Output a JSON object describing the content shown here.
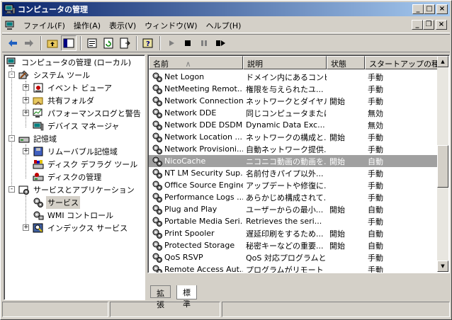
{
  "window": {
    "title": "コンピュータの管理"
  },
  "menu": [
    "ファイル(F)",
    "操作(A)",
    "表示(V)",
    "ウィンドウ(W)",
    "ヘルプ(H)"
  ],
  "tree": {
    "root": "コンピュータの管理 (ローカル)",
    "items": [
      {
        "label": "システム ツール",
        "level": 1,
        "icon": "tools-icon",
        "expander": "-"
      },
      {
        "label": "イベント ビューア",
        "level": 2,
        "icon": "event-viewer-icon",
        "expander": "+"
      },
      {
        "label": "共有フォルダ",
        "level": 2,
        "icon": "shared-folder-icon",
        "expander": "+"
      },
      {
        "label": "パフォーマンスログと警告",
        "level": 2,
        "icon": "performance-icon",
        "expander": "+"
      },
      {
        "label": "デバイス マネージャ",
        "level": 2,
        "icon": "device-manager-icon",
        "expander": ""
      },
      {
        "label": "記憶域",
        "level": 1,
        "icon": "storage-icon",
        "expander": "-"
      },
      {
        "label": "リムーバブル記憶域",
        "level": 2,
        "icon": "removable-storage-icon",
        "expander": "+"
      },
      {
        "label": "ディスク デフラグ ツール",
        "level": 2,
        "icon": "defrag-icon",
        "expander": ""
      },
      {
        "label": "ディスクの管理",
        "level": 2,
        "icon": "disk-management-icon",
        "expander": ""
      },
      {
        "label": "サービスとアプリケーション",
        "level": 1,
        "icon": "services-apps-icon",
        "expander": "-"
      },
      {
        "label": "サービス",
        "level": 2,
        "icon": "services-icon",
        "expander": "",
        "selected": true
      },
      {
        "label": "WMI コントロール",
        "level": 2,
        "icon": "wmi-icon",
        "expander": ""
      },
      {
        "label": "インデックス サービス",
        "level": 2,
        "icon": "index-service-icon",
        "expander": "+"
      }
    ]
  },
  "columns": [
    "名前",
    "説明",
    "状態",
    "スタートアップの種類"
  ],
  "services": [
    {
      "name": "Net Logon",
      "desc": "ドメイン内にあるコンピ...",
      "status": "",
      "startup": "手動"
    },
    {
      "name": "NetMeeting Remot...",
      "desc": "権限を与えられたユ...",
      "status": "",
      "startup": "手動"
    },
    {
      "name": "Network Connections",
      "desc": "ネットワークとダイヤル...",
      "status": "開始",
      "startup": "手動"
    },
    {
      "name": "Network DDE",
      "desc": "同じコンピュータまたは...",
      "status": "",
      "startup": "無効"
    },
    {
      "name": "Network DDE DSDM",
      "desc": "Dynamic Data Exc...",
      "status": "",
      "startup": "無効"
    },
    {
      "name": "Network Location ...",
      "desc": "ネットワークの構成と...",
      "status": "開始",
      "startup": "手動"
    },
    {
      "name": "Network Provisioni...",
      "desc": "自動ネットワーク提供...",
      "status": "",
      "startup": "手動"
    },
    {
      "name": "NicoCache",
      "desc": "ニコニコ動画の動画を...",
      "status": "開始",
      "startup": "自動",
      "selected": true
    },
    {
      "name": "NT LM Security Sup...",
      "desc": "名前付きパイプ以外...",
      "status": "",
      "startup": "手動"
    },
    {
      "name": "Office Source Engine",
      "desc": "アップデートや修復に...",
      "status": "",
      "startup": "手動"
    },
    {
      "name": "Performance Logs ...",
      "desc": "あらかじめ構成されて...",
      "status": "",
      "startup": "手動"
    },
    {
      "name": "Plug and Play",
      "desc": "ユーザーからの最小...",
      "status": "開始",
      "startup": "自動"
    },
    {
      "name": "Portable Media Seri...",
      "desc": "Retrieves the seri...",
      "status": "",
      "startup": "手動"
    },
    {
      "name": "Print Spooler",
      "desc": "遅延印刷をするため...",
      "status": "開始",
      "startup": "自動"
    },
    {
      "name": "Protected Storage",
      "desc": "秘密キーなどの重要...",
      "status": "開始",
      "startup": "自動"
    },
    {
      "name": "QoS RSVP",
      "desc": "QoS 対応プログラムと...",
      "status": "",
      "startup": "手動"
    },
    {
      "name": "Remote Access Aut...",
      "desc": "プログラムがリモート D...",
      "status": "",
      "startup": "手動"
    }
  ],
  "tabs": [
    "拡張",
    "標準"
  ],
  "colors": {
    "title_start": "#0a246a",
    "title_end": "#a6caf0",
    "selected_row": "#a0a0a0"
  }
}
